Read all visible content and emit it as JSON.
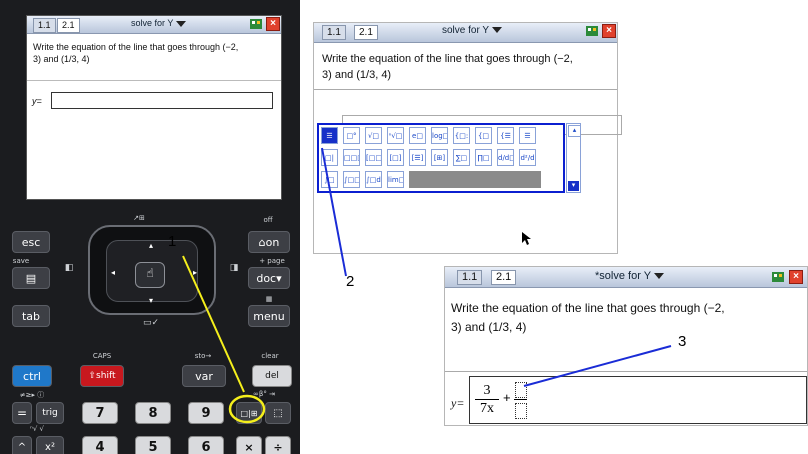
{
  "device": {
    "screen": {
      "tabs": [
        "1.1",
        "2.1"
      ],
      "active_tab": "2.1",
      "doc_title": "solve for Y",
      "question": [
        "Write the equation of the line that goes through (−2,",
        "3) and (1/3, 4)"
      ],
      "answer_label": "y="
    },
    "keys": {
      "esc": "esc",
      "on": "on",
      "save": "save",
      "page": "+ page",
      "doc": "doc",
      "off": "off",
      "tab": "tab",
      "menu": "menu",
      "caps": "CAPS",
      "ctrl": "ctrl",
      "shift": "shift",
      "sto": "sto→",
      "var": "var",
      "clear": "clear",
      "del": "del",
      "eq": "=",
      "trig": "trig",
      "seven": "7",
      "eight": "8",
      "nine": "9",
      "template": "□|⊞",
      "catalog": "⬚",
      "caret": "^",
      "xsq": "x²",
      "four": "4",
      "five": "5",
      "six": "6",
      "times": "×",
      "divide": "÷"
    }
  },
  "screen2": {
    "tabs": [
      "1.1",
      "2.1"
    ],
    "active_tab": "2.1",
    "doc_title": "solve for Y",
    "question": [
      "Write the equation of the line that goes through (−2,",
      "3) and (1/3, 4)"
    ],
    "palette": [
      [
        "☰",
        "□°",
        "√□",
        "ⁿ√□",
        "e□",
        "log□",
        "{□:",
        "{□",
        "{☰",
        "☰"
      ],
      [
        "□|",
        "□□□",
        "[□□]",
        "[□]",
        "[☰]",
        "[⊞]",
        "∑□",
        "∏□",
        "d/d□",
        "d²/d"
      ],
      [
        "∫□",
        "∫□□",
        "∫□d",
        "lim□"
      ]
    ]
  },
  "screen3": {
    "tabs": [
      "1.1",
      "2.1"
    ],
    "active_tab": "2.1",
    "doc_title": "*solve for Y",
    "question": [
      "Write the equation of the line that goes through (−2,",
      "3) and (1/3, 4)"
    ],
    "answer_label": "y=",
    "fraction": {
      "numerator": "3",
      "denominator": "7x"
    },
    "plus": "+"
  },
  "callouts": [
    "1",
    "2",
    "3"
  ],
  "colors": {
    "highlight_yellow": "#f5ef1c",
    "pointer_blue": "#1a2cd6",
    "palette_border": "#0b1fd0"
  }
}
